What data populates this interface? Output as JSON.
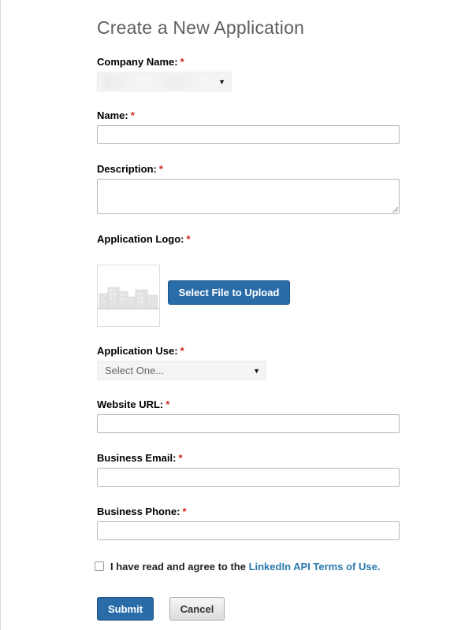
{
  "page": {
    "title": "Create a New Application",
    "required_marker": "*"
  },
  "fields": {
    "company_name": {
      "label": "Company Name:",
      "value": ""
    },
    "name": {
      "label": "Name:",
      "value": ""
    },
    "description": {
      "label": "Description:",
      "value": ""
    },
    "application_logo": {
      "label": "Application Logo:",
      "upload_button": "Select File to Upload"
    },
    "application_use": {
      "label": "Application Use:",
      "value": "Select One..."
    },
    "website_url": {
      "label": "Website URL:",
      "value": ""
    },
    "business_email": {
      "label": "Business Email:",
      "value": ""
    },
    "business_phone": {
      "label": "Business Phone:",
      "value": ""
    }
  },
  "terms": {
    "checked": false,
    "prefix": "I have read and agree to the ",
    "link_text": "LinkedIn API Terms of Use."
  },
  "actions": {
    "submit_label": "Submit",
    "cancel_label": "Cancel"
  },
  "icons": {
    "select_caret": "chevron-down-icon",
    "logo_placeholder": "buildings-icon"
  },
  "colors": {
    "primary_button": "#2a6ca8",
    "required": "#d0271d",
    "link": "#2a7aad",
    "title": "#5f5f5f"
  }
}
